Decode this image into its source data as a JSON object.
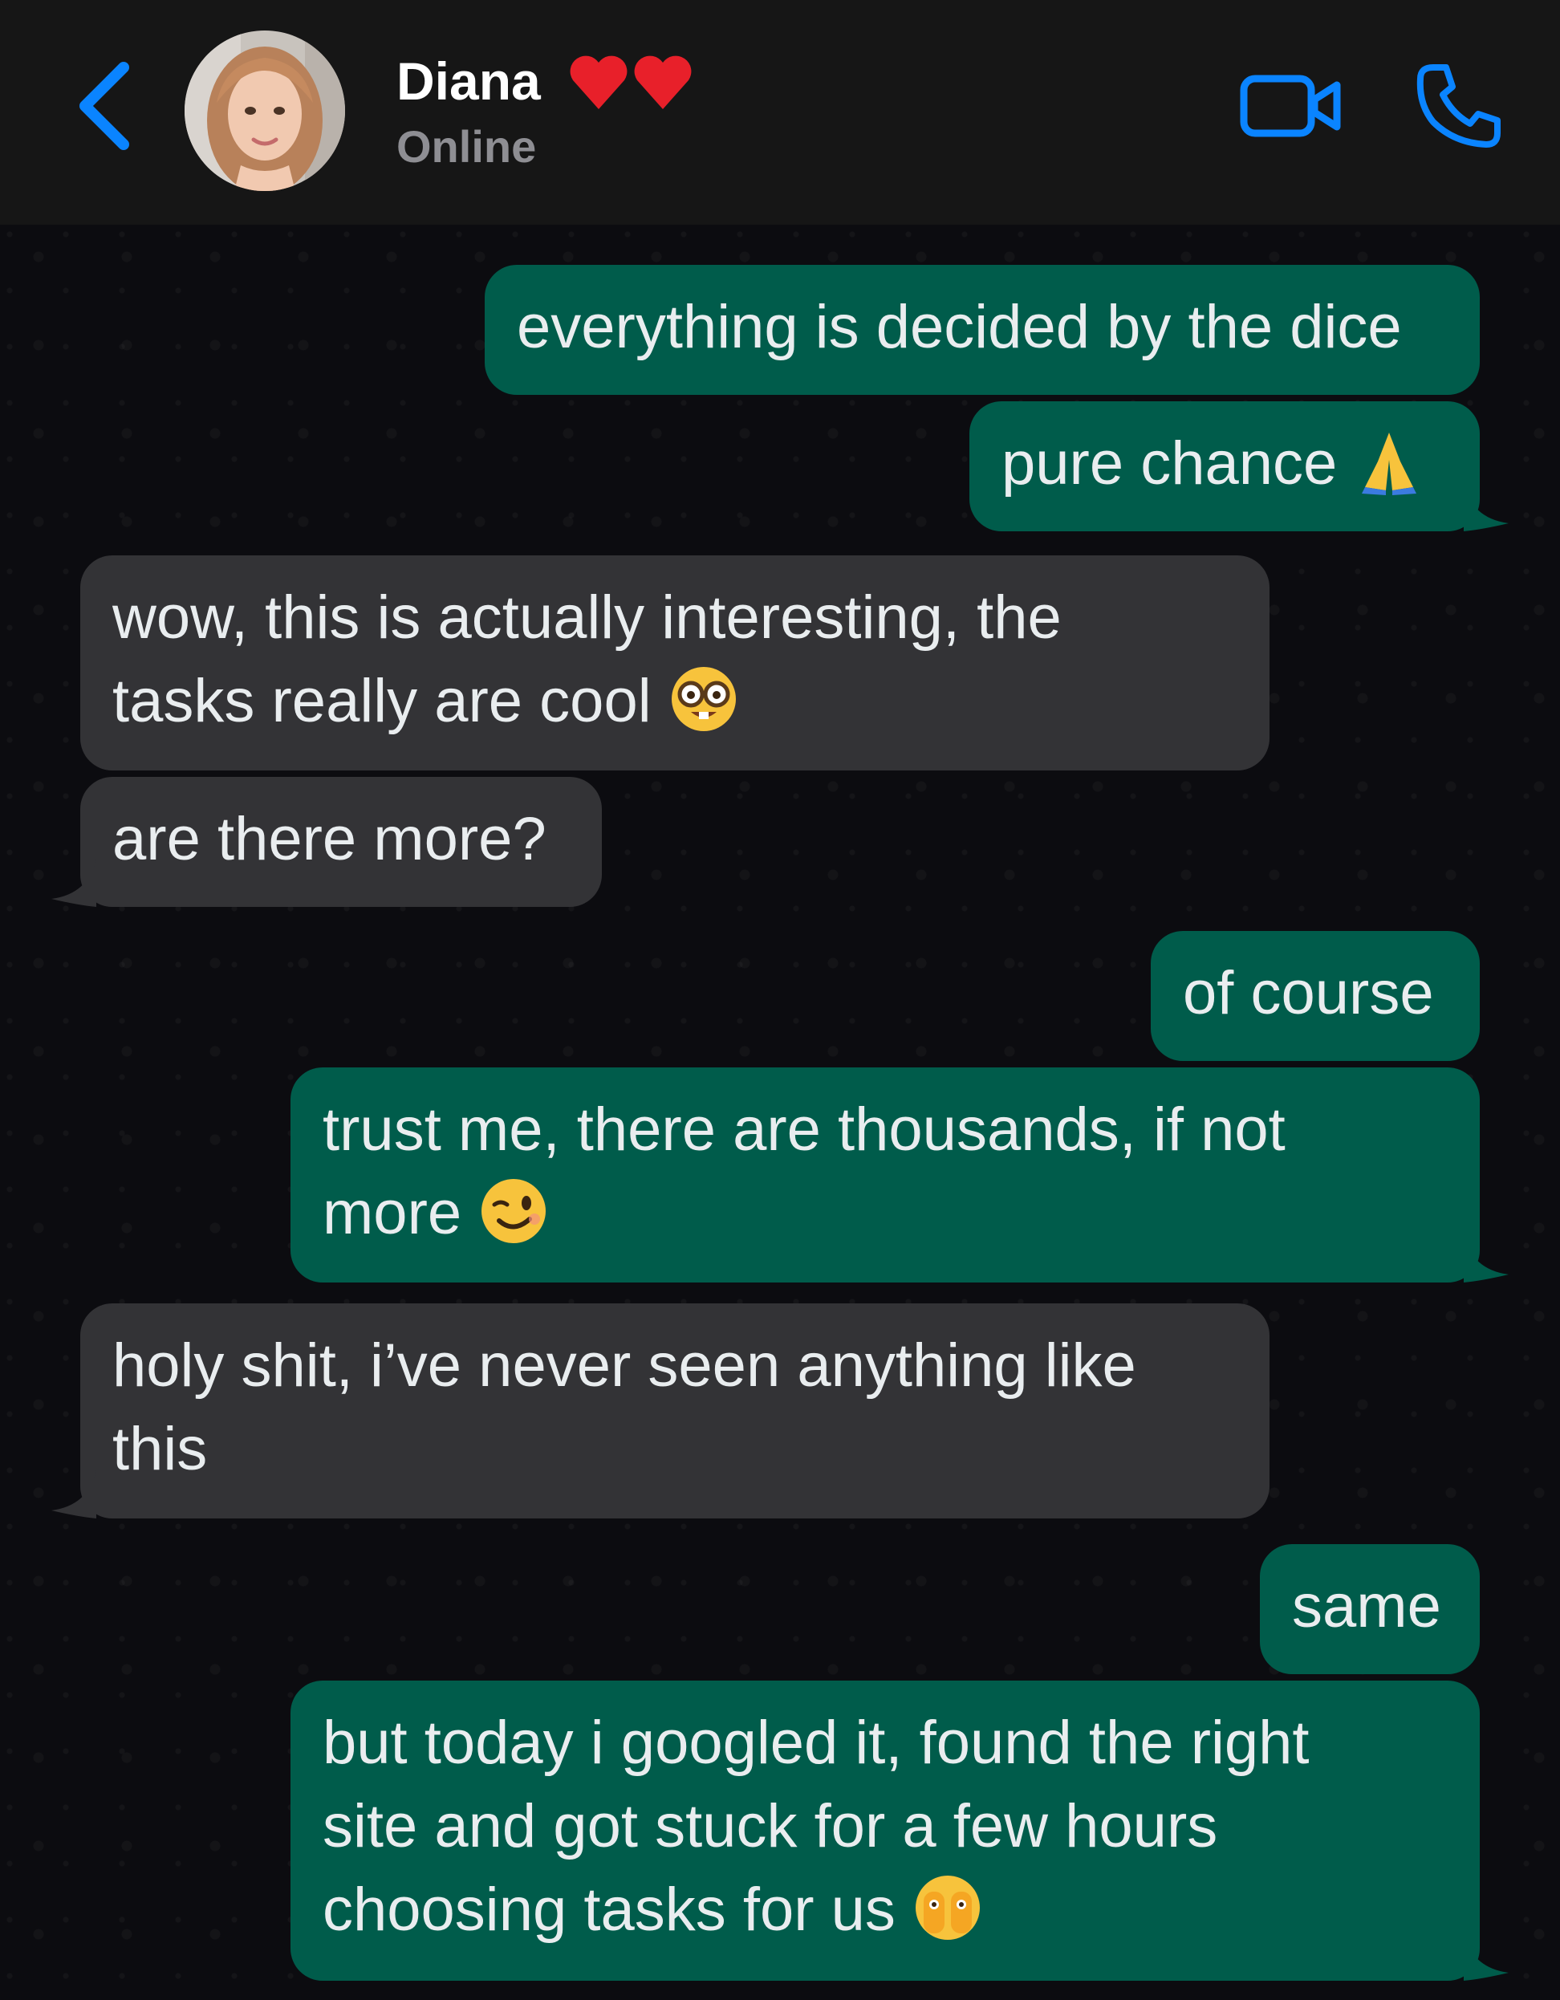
{
  "header": {
    "contact_name": "Diana",
    "status": "Online",
    "name_decoration_icon": "two-red-hearts",
    "accent_color": "#0a84ff"
  },
  "messages": [
    {
      "direction": "outgoing",
      "text": "everything is decided by the dice",
      "emoji": ""
    },
    {
      "direction": "outgoing",
      "text": "pure chance ",
      "emoji": "folded-hands-icon"
    },
    {
      "direction": "incoming",
      "text": "wow, this is actually interesting, the\ntasks really are cool ",
      "emoji": "nerd-face-icon"
    },
    {
      "direction": "incoming",
      "text": "are there more?",
      "emoji": ""
    },
    {
      "direction": "outgoing",
      "text": "of course",
      "emoji": ""
    },
    {
      "direction": "outgoing",
      "text": "trust me, there are thousands, if not\nmore ",
      "emoji": "winking-face-icon"
    },
    {
      "direction": "incoming",
      "text": "holy shit, i’ve never seen anything like\nthis",
      "emoji": ""
    },
    {
      "direction": "outgoing",
      "text": "same",
      "emoji": ""
    },
    {
      "direction": "outgoing",
      "text": "but today i googled it, found the right\nsite and got stuck for a few hours\nchoosing tasks for us ",
      "emoji": "face-with-open-eyes-and-hand-over-mouth-icon"
    }
  ],
  "colors": {
    "outgoing_bubble": "#005c4b",
    "incoming_bubble": "#333336",
    "header_background": "#161616",
    "chat_background": "#0c0c10"
  }
}
